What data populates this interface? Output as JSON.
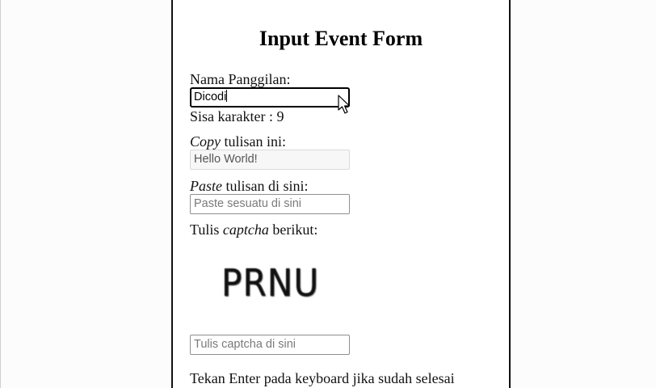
{
  "form": {
    "title": "Input Event Form",
    "nickname": {
      "label": "Nama Panggilan:",
      "value": "Dicodi",
      "remaining_text": "Sisa karakter : 9"
    },
    "copy": {
      "label_em": "Copy",
      "label_rest": " tulisan ini:",
      "value": "Hello World!"
    },
    "paste": {
      "label_em": "Paste",
      "label_rest": " tulisan di sini:",
      "placeholder": "Paste sesuatu di sini"
    },
    "captcha": {
      "label_prefix": "Tulis ",
      "label_em": "captcha",
      "label_suffix": " berikut:",
      "image_text": "PRNU",
      "placeholder": "Tulis captcha di sini"
    },
    "instruction": "Tekan Enter pada keyboard jika sudah selesai"
  },
  "icons": {
    "cursor": "mouse-pointer-icon"
  },
  "colors": {
    "panel_border": "#111111",
    "page_background": "#fcfcfc"
  }
}
